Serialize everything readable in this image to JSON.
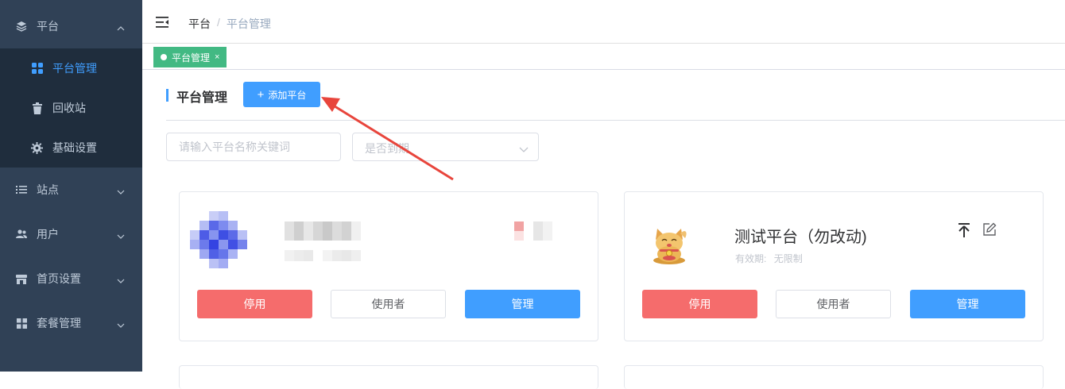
{
  "sidebar": {
    "groups": [
      {
        "label": "平台",
        "icon": "layers-icon",
        "expanded": true
      },
      {
        "label": "站点",
        "icon": "list-icon"
      },
      {
        "label": "用户",
        "icon": "users-icon"
      },
      {
        "label": "首页设置",
        "icon": "store-icon"
      },
      {
        "label": "套餐管理",
        "icon": "apps-icon"
      }
    ],
    "sub_items": [
      {
        "label": "平台管理",
        "icon": "grid-icon",
        "active": true
      },
      {
        "label": "回收站",
        "icon": "trash-icon"
      },
      {
        "label": "基础设置",
        "icon": "gear-icon"
      }
    ]
  },
  "header": {
    "breadcrumb": [
      "平台",
      "平台管理"
    ],
    "separator": "/"
  },
  "tags": [
    {
      "label": "平台管理",
      "close": "×"
    }
  ],
  "main": {
    "title": "平台管理",
    "add_button": "添加平台",
    "add_button_icon": "+",
    "search": {
      "placeholder": "请输入平台名称关键词"
    },
    "filter": {
      "placeholder": "是否到期"
    }
  },
  "cards": [
    {
      "name": "",
      "validity": "",
      "buttons": {
        "stop": "停用",
        "users": "使用者",
        "manage": "管理"
      }
    },
    {
      "name": "测试平台（勿改动)",
      "validity_label": "有效期:",
      "validity_value": "无限制",
      "buttons": {
        "stop": "停用",
        "users": "使用者",
        "manage": "管理"
      }
    }
  ],
  "colors": {
    "sidebar_bg": "#304156",
    "sidebar_sub_bg": "#1f2d3d",
    "primary": "#409eff",
    "danger": "#f56c6c",
    "tag_green": "#42b983",
    "arrow_red": "#e8453c"
  }
}
